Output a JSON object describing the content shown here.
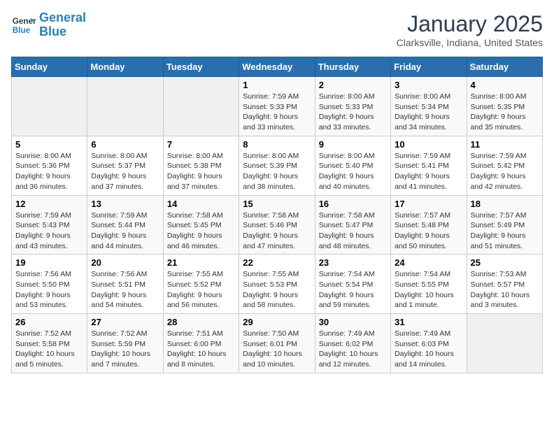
{
  "logo": {
    "line1": "General",
    "line2": "Blue"
  },
  "title": "January 2025",
  "subtitle": "Clarksville, Indiana, United States",
  "weekdays": [
    "Sunday",
    "Monday",
    "Tuesday",
    "Wednesday",
    "Thursday",
    "Friday",
    "Saturday"
  ],
  "weeks": [
    [
      {
        "day": "",
        "info": ""
      },
      {
        "day": "",
        "info": ""
      },
      {
        "day": "",
        "info": ""
      },
      {
        "day": "1",
        "info": "Sunrise: 7:59 AM\nSunset: 5:33 PM\nDaylight: 9 hours and 33 minutes."
      },
      {
        "day": "2",
        "info": "Sunrise: 8:00 AM\nSunset: 5:33 PM\nDaylight: 9 hours and 33 minutes."
      },
      {
        "day": "3",
        "info": "Sunrise: 8:00 AM\nSunset: 5:34 PM\nDaylight: 9 hours and 34 minutes."
      },
      {
        "day": "4",
        "info": "Sunrise: 8:00 AM\nSunset: 5:35 PM\nDaylight: 9 hours and 35 minutes."
      }
    ],
    [
      {
        "day": "5",
        "info": "Sunrise: 8:00 AM\nSunset: 5:36 PM\nDaylight: 9 hours and 36 minutes."
      },
      {
        "day": "6",
        "info": "Sunrise: 8:00 AM\nSunset: 5:37 PM\nDaylight: 9 hours and 37 minutes."
      },
      {
        "day": "7",
        "info": "Sunrise: 8:00 AM\nSunset: 5:38 PM\nDaylight: 9 hours and 37 minutes."
      },
      {
        "day": "8",
        "info": "Sunrise: 8:00 AM\nSunset: 5:39 PM\nDaylight: 9 hours and 38 minutes."
      },
      {
        "day": "9",
        "info": "Sunrise: 8:00 AM\nSunset: 5:40 PM\nDaylight: 9 hours and 40 minutes."
      },
      {
        "day": "10",
        "info": "Sunrise: 7:59 AM\nSunset: 5:41 PM\nDaylight: 9 hours and 41 minutes."
      },
      {
        "day": "11",
        "info": "Sunrise: 7:59 AM\nSunset: 5:42 PM\nDaylight: 9 hours and 42 minutes."
      }
    ],
    [
      {
        "day": "12",
        "info": "Sunrise: 7:59 AM\nSunset: 5:43 PM\nDaylight: 9 hours and 43 minutes."
      },
      {
        "day": "13",
        "info": "Sunrise: 7:59 AM\nSunset: 5:44 PM\nDaylight: 9 hours and 44 minutes."
      },
      {
        "day": "14",
        "info": "Sunrise: 7:58 AM\nSunset: 5:45 PM\nDaylight: 9 hours and 46 minutes."
      },
      {
        "day": "15",
        "info": "Sunrise: 7:58 AM\nSunset: 5:46 PM\nDaylight: 9 hours and 47 minutes."
      },
      {
        "day": "16",
        "info": "Sunrise: 7:58 AM\nSunset: 5:47 PM\nDaylight: 9 hours and 48 minutes."
      },
      {
        "day": "17",
        "info": "Sunrise: 7:57 AM\nSunset: 5:48 PM\nDaylight: 9 hours and 50 minutes."
      },
      {
        "day": "18",
        "info": "Sunrise: 7:57 AM\nSunset: 5:49 PM\nDaylight: 9 hours and 51 minutes."
      }
    ],
    [
      {
        "day": "19",
        "info": "Sunrise: 7:56 AM\nSunset: 5:50 PM\nDaylight: 9 hours and 53 minutes."
      },
      {
        "day": "20",
        "info": "Sunrise: 7:56 AM\nSunset: 5:51 PM\nDaylight: 9 hours and 54 minutes."
      },
      {
        "day": "21",
        "info": "Sunrise: 7:55 AM\nSunset: 5:52 PM\nDaylight: 9 hours and 56 minutes."
      },
      {
        "day": "22",
        "info": "Sunrise: 7:55 AM\nSunset: 5:53 PM\nDaylight: 9 hours and 58 minutes."
      },
      {
        "day": "23",
        "info": "Sunrise: 7:54 AM\nSunset: 5:54 PM\nDaylight: 9 hours and 59 minutes."
      },
      {
        "day": "24",
        "info": "Sunrise: 7:54 AM\nSunset: 5:55 PM\nDaylight: 10 hours and 1 minute."
      },
      {
        "day": "25",
        "info": "Sunrise: 7:53 AM\nSunset: 5:57 PM\nDaylight: 10 hours and 3 minutes."
      }
    ],
    [
      {
        "day": "26",
        "info": "Sunrise: 7:52 AM\nSunset: 5:58 PM\nDaylight: 10 hours and 5 minutes."
      },
      {
        "day": "27",
        "info": "Sunrise: 7:52 AM\nSunset: 5:59 PM\nDaylight: 10 hours and 7 minutes."
      },
      {
        "day": "28",
        "info": "Sunrise: 7:51 AM\nSunset: 6:00 PM\nDaylight: 10 hours and 8 minutes."
      },
      {
        "day": "29",
        "info": "Sunrise: 7:50 AM\nSunset: 6:01 PM\nDaylight: 10 hours and 10 minutes."
      },
      {
        "day": "30",
        "info": "Sunrise: 7:49 AM\nSunset: 6:02 PM\nDaylight: 10 hours and 12 minutes."
      },
      {
        "day": "31",
        "info": "Sunrise: 7:49 AM\nSunset: 6:03 PM\nDaylight: 10 hours and 14 minutes."
      },
      {
        "day": "",
        "info": ""
      }
    ]
  ]
}
